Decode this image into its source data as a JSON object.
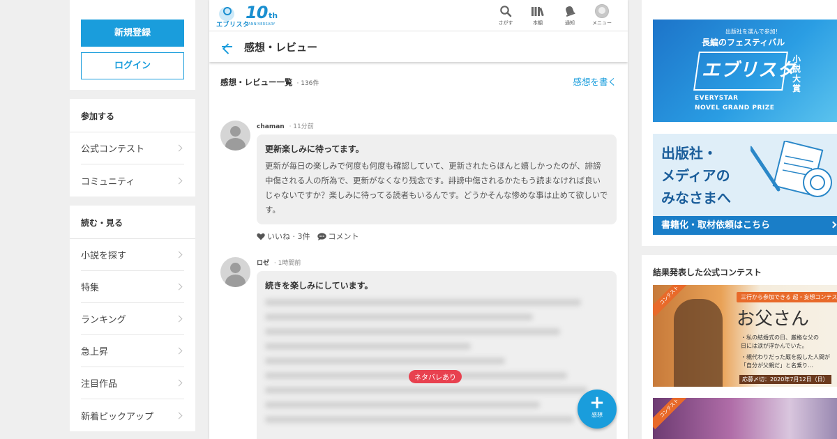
{
  "auth": {
    "register_label": "新規登録",
    "login_label": "ログイン"
  },
  "menu_join": {
    "heading": "参加する",
    "items": [
      {
        "label": "公式コンテスト"
      },
      {
        "label": "コミュニティ"
      }
    ]
  },
  "menu_read": {
    "heading": "読む・見る",
    "items": [
      {
        "label": "小説を探す"
      },
      {
        "label": "特集"
      },
      {
        "label": "ランキング"
      },
      {
        "label": "急上昇"
      },
      {
        "label": "注目作品"
      },
      {
        "label": "新着ピックアップ"
      }
    ]
  },
  "header": {
    "logo_text": "エブリスタ",
    "logo_10": "10",
    "logo_th": "th",
    "logo_anniversary": "ANNIVERSARY",
    "nav": [
      {
        "label": "さがす",
        "icon": "search-icon"
      },
      {
        "label": "本棚",
        "icon": "bookshelf-icon"
      },
      {
        "label": "通知",
        "icon": "bell-icon"
      },
      {
        "label": "メニュー",
        "icon": "avatar-icon"
      }
    ]
  },
  "page": {
    "title": "感想・レビュー"
  },
  "list": {
    "title": "感想・レビュー一覧",
    "count": "· 136件",
    "write_label": "感想を書く"
  },
  "reviews": [
    {
      "user": "chaman",
      "time": "· 11分前",
      "title": "更新楽しみに待ってます。",
      "body": "更新が毎日の楽しみで何度も何度も確認していて、更新されたらほんと嬉しかったのが、誹謗中傷される人の所為で、更新がなくなり残念です。誹謗中傷されるかたもう読まなければ良いじゃないですか？楽しみに待ってる読者もいるんです。どうかそんな惨めな事は止めて欲しいです。",
      "like_label": "いいね · 3件",
      "comment_label": "コメント"
    },
    {
      "user": "ロゼ",
      "time": "· 1時間前",
      "title": "続きを楽しみにしています。",
      "spoiler_label": "ネタバレあり"
    }
  ],
  "fab": {
    "label": "感想"
  },
  "banners": {
    "festival": {
      "small": "出版社を選んで参加！",
      "title": "長編のフェスティバル",
      "big": "エブリスタ",
      "side": "小説大賞",
      "en1": "EVERYSTAR",
      "en2": "NOVEL GRAND PRIZE"
    },
    "publisher": {
      "line1": "出版社・",
      "line2": "メディアの",
      "line3": "みなさまへ",
      "footer": "書籍化・取材依頼はこちら"
    }
  },
  "contests": {
    "heading": "結果発表した公式コンテスト",
    "c1": {
      "ribbon": "コンテスト",
      "tag": "三行から参加できる 超・妄想コンテスト",
      "title": "お父さん",
      "line1": "・私の結婚式の日、厳格な父の",
      "line2": "日には涙が浮かんでいた。",
      "line3": "・親代わりだった厩を殺した人間が",
      "line4": "「自分が父親だ」と名乗り…",
      "date": "応募〆切：2020年7月12日（日）"
    },
    "c2": {
      "ribbon": "コンテスト"
    }
  },
  "colors": {
    "accent": "#1a9ddc",
    "spoiler": "#e8414f"
  }
}
